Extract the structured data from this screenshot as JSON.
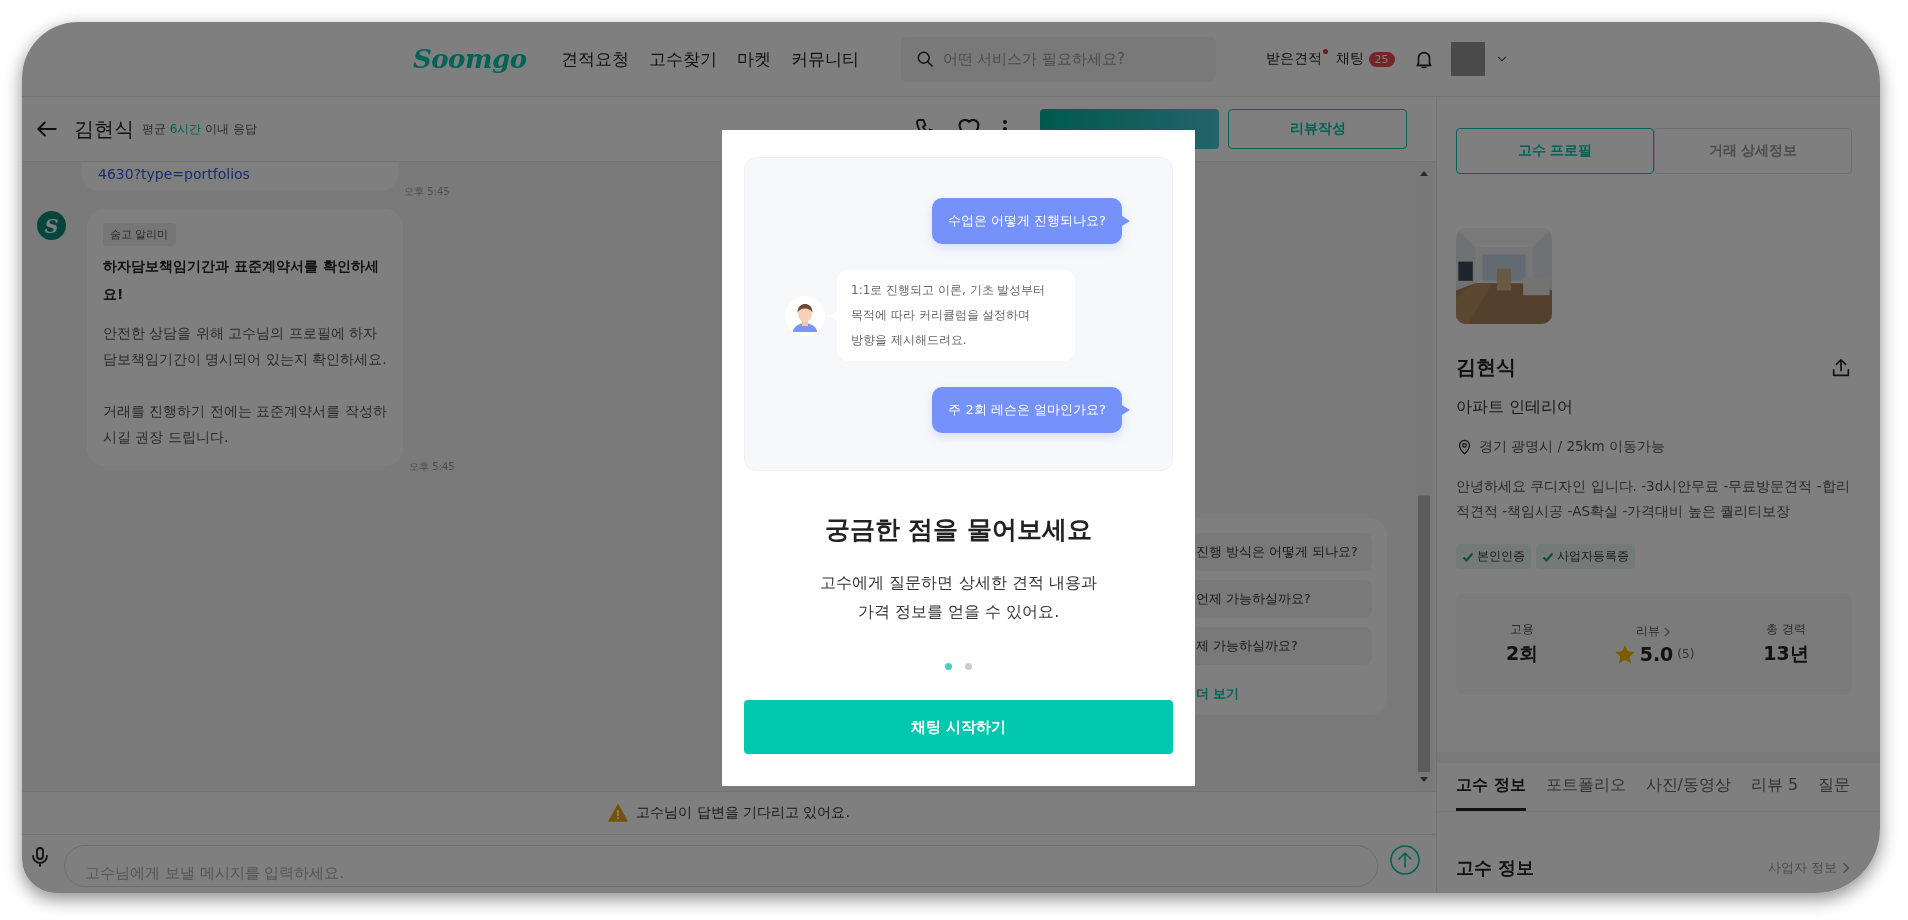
{
  "header": {
    "logo": "Soomgo",
    "nav": [
      {
        "label": "견적요청"
      },
      {
        "label": "고수찾기"
      },
      {
        "label": "마켓"
      },
      {
        "label": "커뮤니티"
      }
    ],
    "search": {
      "placeholder": "어떤 서비스가 필요하세요?"
    },
    "quotes": {
      "label": "받은견적",
      "unread": true
    },
    "chat": {
      "label": "채팅",
      "count": "25"
    }
  },
  "chat_header": {
    "name": "김현식",
    "response": {
      "prefix": "평균",
      "highlight": "6시간",
      "suffix": "이내 응답"
    },
    "buttons": [
      {
        "kind": "primary"
      },
      {
        "label": "리뷰작성",
        "kind": "outline"
      }
    ]
  },
  "messages": [
    {
      "kind": "link",
      "text": "4630?type=portfolios",
      "time": "오후 5:45"
    },
    {
      "kind": "notice",
      "avatar_letter": "S",
      "tag": "숨고 알리미",
      "title": "하자담보책임기간과 표준계약서를 확인하세요!",
      "paragraphs": [
        "안전한 상담을 위해 고수님의 프로필에 하자담보책임기간이 명시되어 있는지 확인하세요.",
        "거래를 진행하기 전에는 표준계약서를 작성하시길 권장 드립니다."
      ],
      "time": "오후 5:45"
    }
  ],
  "quick_questions": {
    "items": [
      {
        "text": "진행 방식은 어떻게 되나요?"
      },
      {
        "text": "언제 가능하실까요?"
      },
      {
        "text": "제 가능하실까요?"
      }
    ],
    "more": "더 보기"
  },
  "waiting": "고수님이 답변을 기다리고 있어요.",
  "composer": {
    "placeholder": "고수님에게 보낼 메시지를 입력하세요."
  },
  "modal": {
    "bubbles": [
      {
        "kind": "question",
        "text": "수업은 어떻게 진행되나요?"
      },
      {
        "kind": "answer",
        "text": "1:1로 진행되고 이론, 기초 발성부터 목적에 따라 커리큘럼을 설정하며 방향을 제시해드려요."
      },
      {
        "kind": "question",
        "text": "주 2회 레슨은 얼마인가요?"
      }
    ],
    "title": "궁금한 점을 물어보세요",
    "subtitle": [
      "고수에게 질문하면 상세한 견적 내용과",
      "가격 정보를 얻을 수 있어요."
    ],
    "dots": [
      {
        "selected": true
      },
      {
        "selected": false
      }
    ],
    "button": "채팅 시작하기"
  },
  "profile": {
    "tabs": [
      {
        "label": "고수 프로필",
        "selected": true
      },
      {
        "label": "거래 상세정보",
        "selected": false
      }
    ],
    "name": "김현식",
    "category": "아파트 인테리어",
    "location": "경기 광명시 / 25km 이동가능",
    "intro": "안녕하세요 쿠디자인 입니다. -3d시안무료 -무료방문견적 -합리적견적 -책임시공 -AS확실 -가격대비 높은 퀄리티보장",
    "badges": [
      {
        "label": "본인인증"
      },
      {
        "label": "사업자등록증"
      }
    ],
    "stats": [
      {
        "kind": "plain",
        "label": "고용",
        "value": "2회"
      },
      {
        "kind": "rating",
        "label": "리뷰",
        "value": "5.0",
        "count": "(5)"
      },
      {
        "kind": "plain",
        "label": "총 경력",
        "value": "13년"
      }
    ],
    "section_tabs": [
      {
        "label": "고수 정보",
        "selected": true
      },
      {
        "label": "포트폴리오",
        "selected": false
      },
      {
        "label": "사진/동영상",
        "selected": false
      },
      {
        "label": "리뷰 5",
        "selected": false
      },
      {
        "label": "질문",
        "selected": false
      }
    ],
    "section": {
      "title": "고수 정보",
      "link": "사업자 정보"
    }
  }
}
